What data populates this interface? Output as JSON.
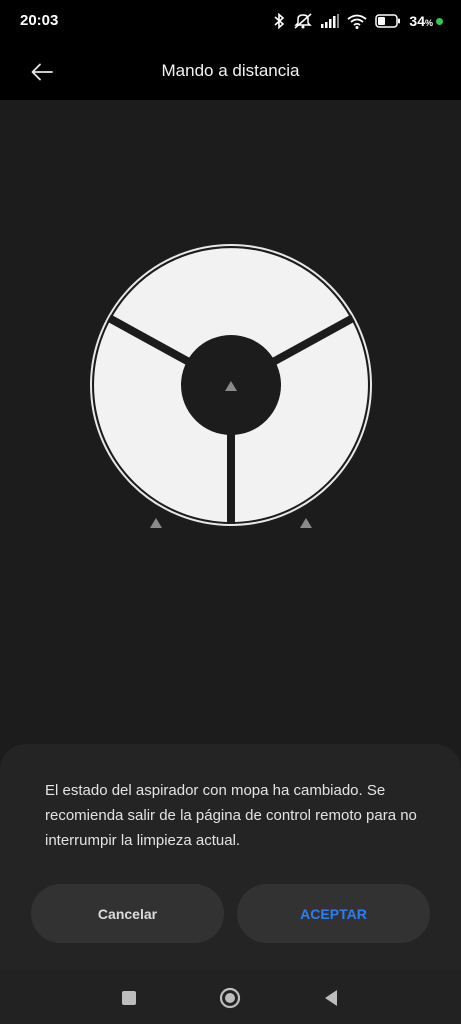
{
  "status_bar": {
    "time": "20:03",
    "battery_percent": "34",
    "battery_unit": "%",
    "icons": [
      "bluetooth-icon",
      "mute-icon",
      "signal-icon",
      "wifi-icon",
      "battery-icon",
      "charging-dot-icon"
    ]
  },
  "header": {
    "title": "Mando a distancia",
    "back_icon": "arrow-left-icon"
  },
  "remote_control": {
    "segments": [
      "forward",
      "rotate-left",
      "rotate-right"
    ],
    "arrow_icons": [
      "triangle-up-icon",
      "triangle-up-icon",
      "triangle-up-icon"
    ]
  },
  "dialog": {
    "message": "El estado del aspirador con mopa ha cambiado. Se recomienda salir de la página de control remoto para no interrumpir la limpieza actual.",
    "cancel_label": "Cancelar",
    "accept_label": "ACEPTAR"
  },
  "nav_bar": {
    "icons": [
      "recents-square-icon",
      "home-circle-icon",
      "back-triangle-icon"
    ]
  },
  "colors": {
    "background": "#1c1c1c",
    "dialog": "#242424",
    "button": "#323232",
    "accent": "#2f7df0",
    "charge": "#34c759"
  }
}
